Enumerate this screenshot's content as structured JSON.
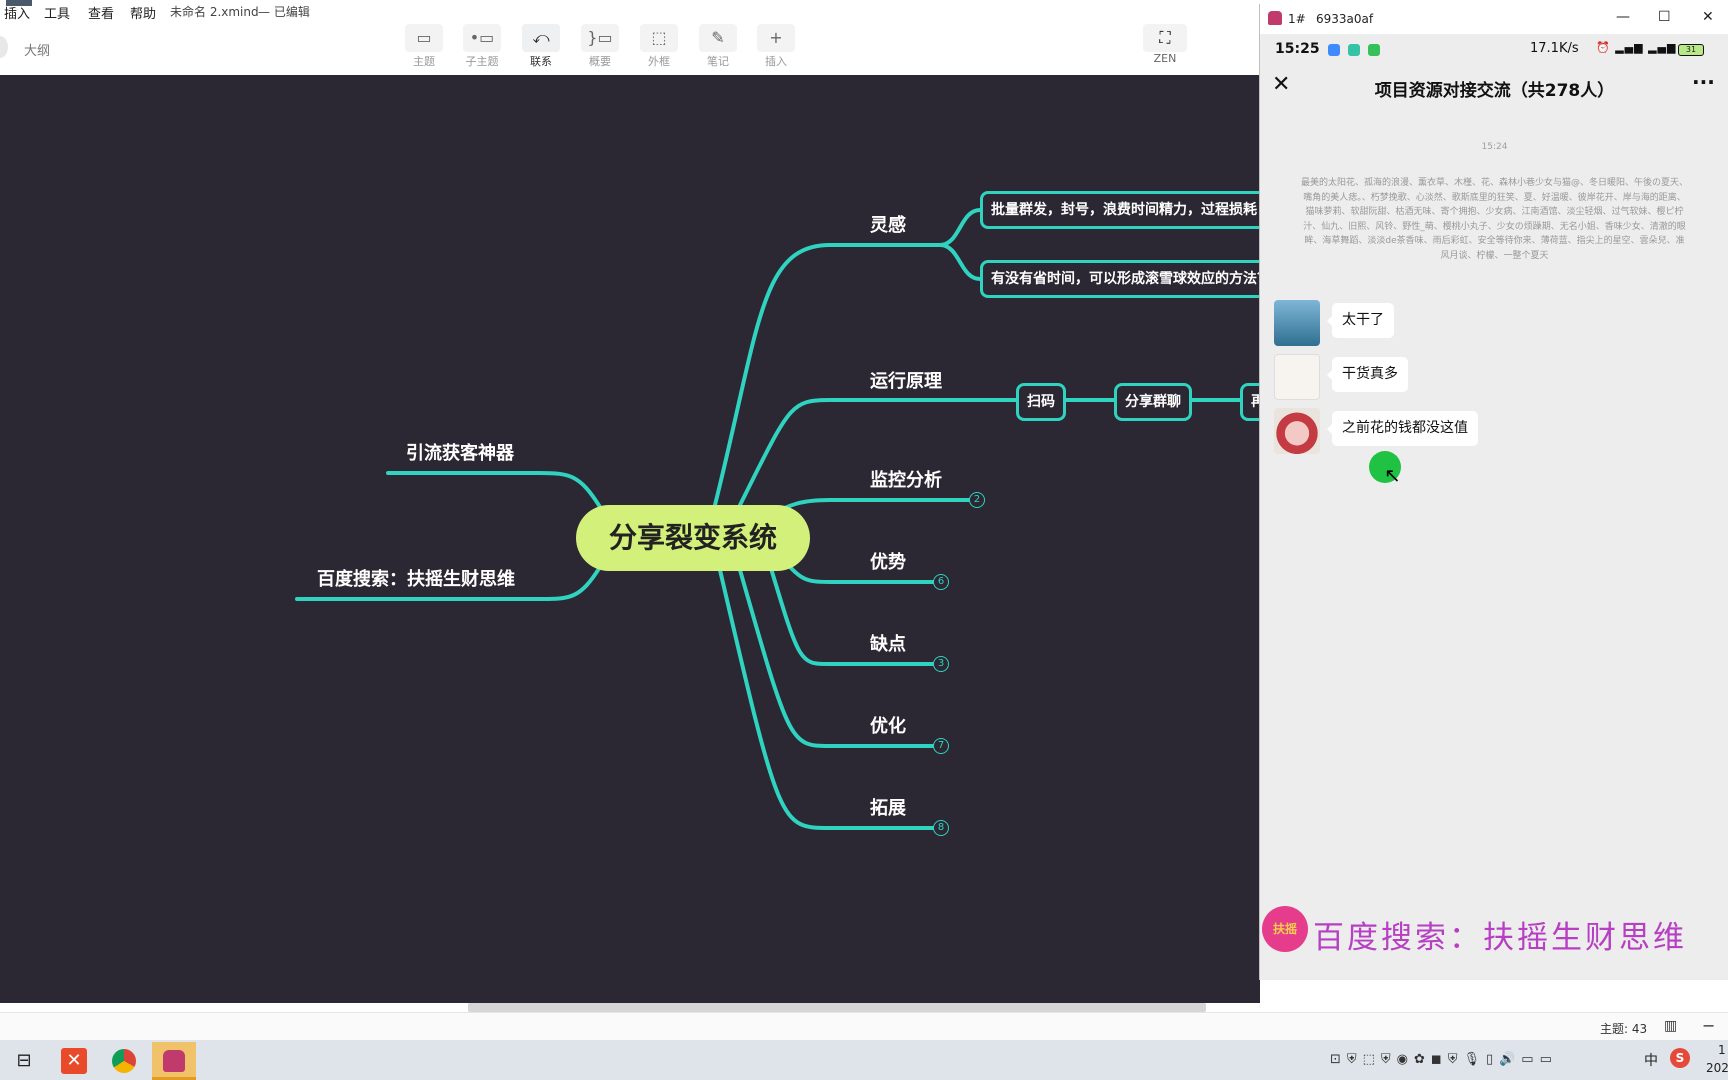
{
  "menubar": {
    "items": [
      "插入",
      "工具",
      "查看",
      "帮助"
    ],
    "document": "未命名 2.xmind",
    "edit_status": "— 已编辑"
  },
  "sidebar": {
    "outline_label": "大纲"
  },
  "toolbar": {
    "buttons": [
      {
        "label": "主题",
        "icon": "topic-icon"
      },
      {
        "label": "子主题",
        "icon": "subtopic-icon"
      },
      {
        "label": "联系",
        "icon": "relationship-icon"
      },
      {
        "label": "概要",
        "icon": "summary-icon"
      },
      {
        "label": "外框",
        "icon": "boundary-icon"
      },
      {
        "label": "笔记",
        "icon": "note-icon"
      },
      {
        "label": "插入",
        "icon": "plus-icon"
      }
    ],
    "zen_label": "ZEN"
  },
  "mindmap": {
    "root": "分享裂变系统",
    "left_branches": [
      "引流获客神器",
      "百度搜索：扶摇生财思维"
    ],
    "right_branches": [
      {
        "label": "灵感"
      },
      {
        "label": "运行原理"
      },
      {
        "label": "监控分析",
        "count": "2"
      },
      {
        "label": "优势",
        "count": "6"
      },
      {
        "label": "缺点",
        "count": "3"
      },
      {
        "label": "优化",
        "count": "7"
      },
      {
        "label": "拓展",
        "count": "8"
      }
    ],
    "inspiration_children": [
      "批量群发，封号，浪费时间精力，过程损耗",
      "有没有省时间，可以形成滚雪球效应的方法？"
    ],
    "principle_children": [
      "扫码",
      "分享群聊",
      "再"
    ],
    "line_color": "#2fd3bf",
    "canvas_color": "#2b2733",
    "root_color": "#d3f07b"
  },
  "statusbar": {
    "topic_count": "主题: 43"
  },
  "phone_window": {
    "title": "1#",
    "device_id": "6933a0af",
    "status": {
      "time": "15:25",
      "network_rate": "17.1K/s",
      "battery": "31"
    },
    "chat": {
      "title": "项目资源对接交流（共278人）",
      "timestamp": "15:24",
      "notice": "最美的太阳花、孤海的浪漫、薰衣草、木槿、花、森林小巷少女与猫@、冬日暖阳、午後の夏天、嘴角的美人痣。、朽梦挽歌、心淡然、歌斯底里的狂笑、夏、好温暖、彼岸花开、岸与海的距离、猫味萝莉、软甜阮甜、枯酒无味、寄个拥抱、少女病、江南酒馆、淡尘轻烟、过气软妹、樱ピ柠汁、仙九、旧熙、风铃、野性_萌、樱桃小丸子、少女の烦躁期、无名小姐、香味少女、清澈的眼眸、海草舞蹈、淡淡de茶香味、雨后彩虹、安全等待你来、薄荷蓝、指尖上的星空、雲朵兒、准风月谈、柠檬、一整个夏天",
      "messages": [
        {
          "text": "太干了",
          "avatar": "avatar-lake-girl"
        },
        {
          "text": "干货真多",
          "avatar": "avatar-white-cat"
        },
        {
          "text": "之前花的钱都没这值",
          "avatar": "avatar-red-devil"
        }
      ]
    },
    "watermark": "百度搜索：扶摇生财思维",
    "watermark_logo": "扶摇"
  },
  "taskbar": {
    "apps": [
      "taskview-icon",
      "xmind-app-icon",
      "chrome-icon",
      "android-icon"
    ],
    "ime_label": "中",
    "clock_time": "1",
    "clock_date": "202"
  }
}
